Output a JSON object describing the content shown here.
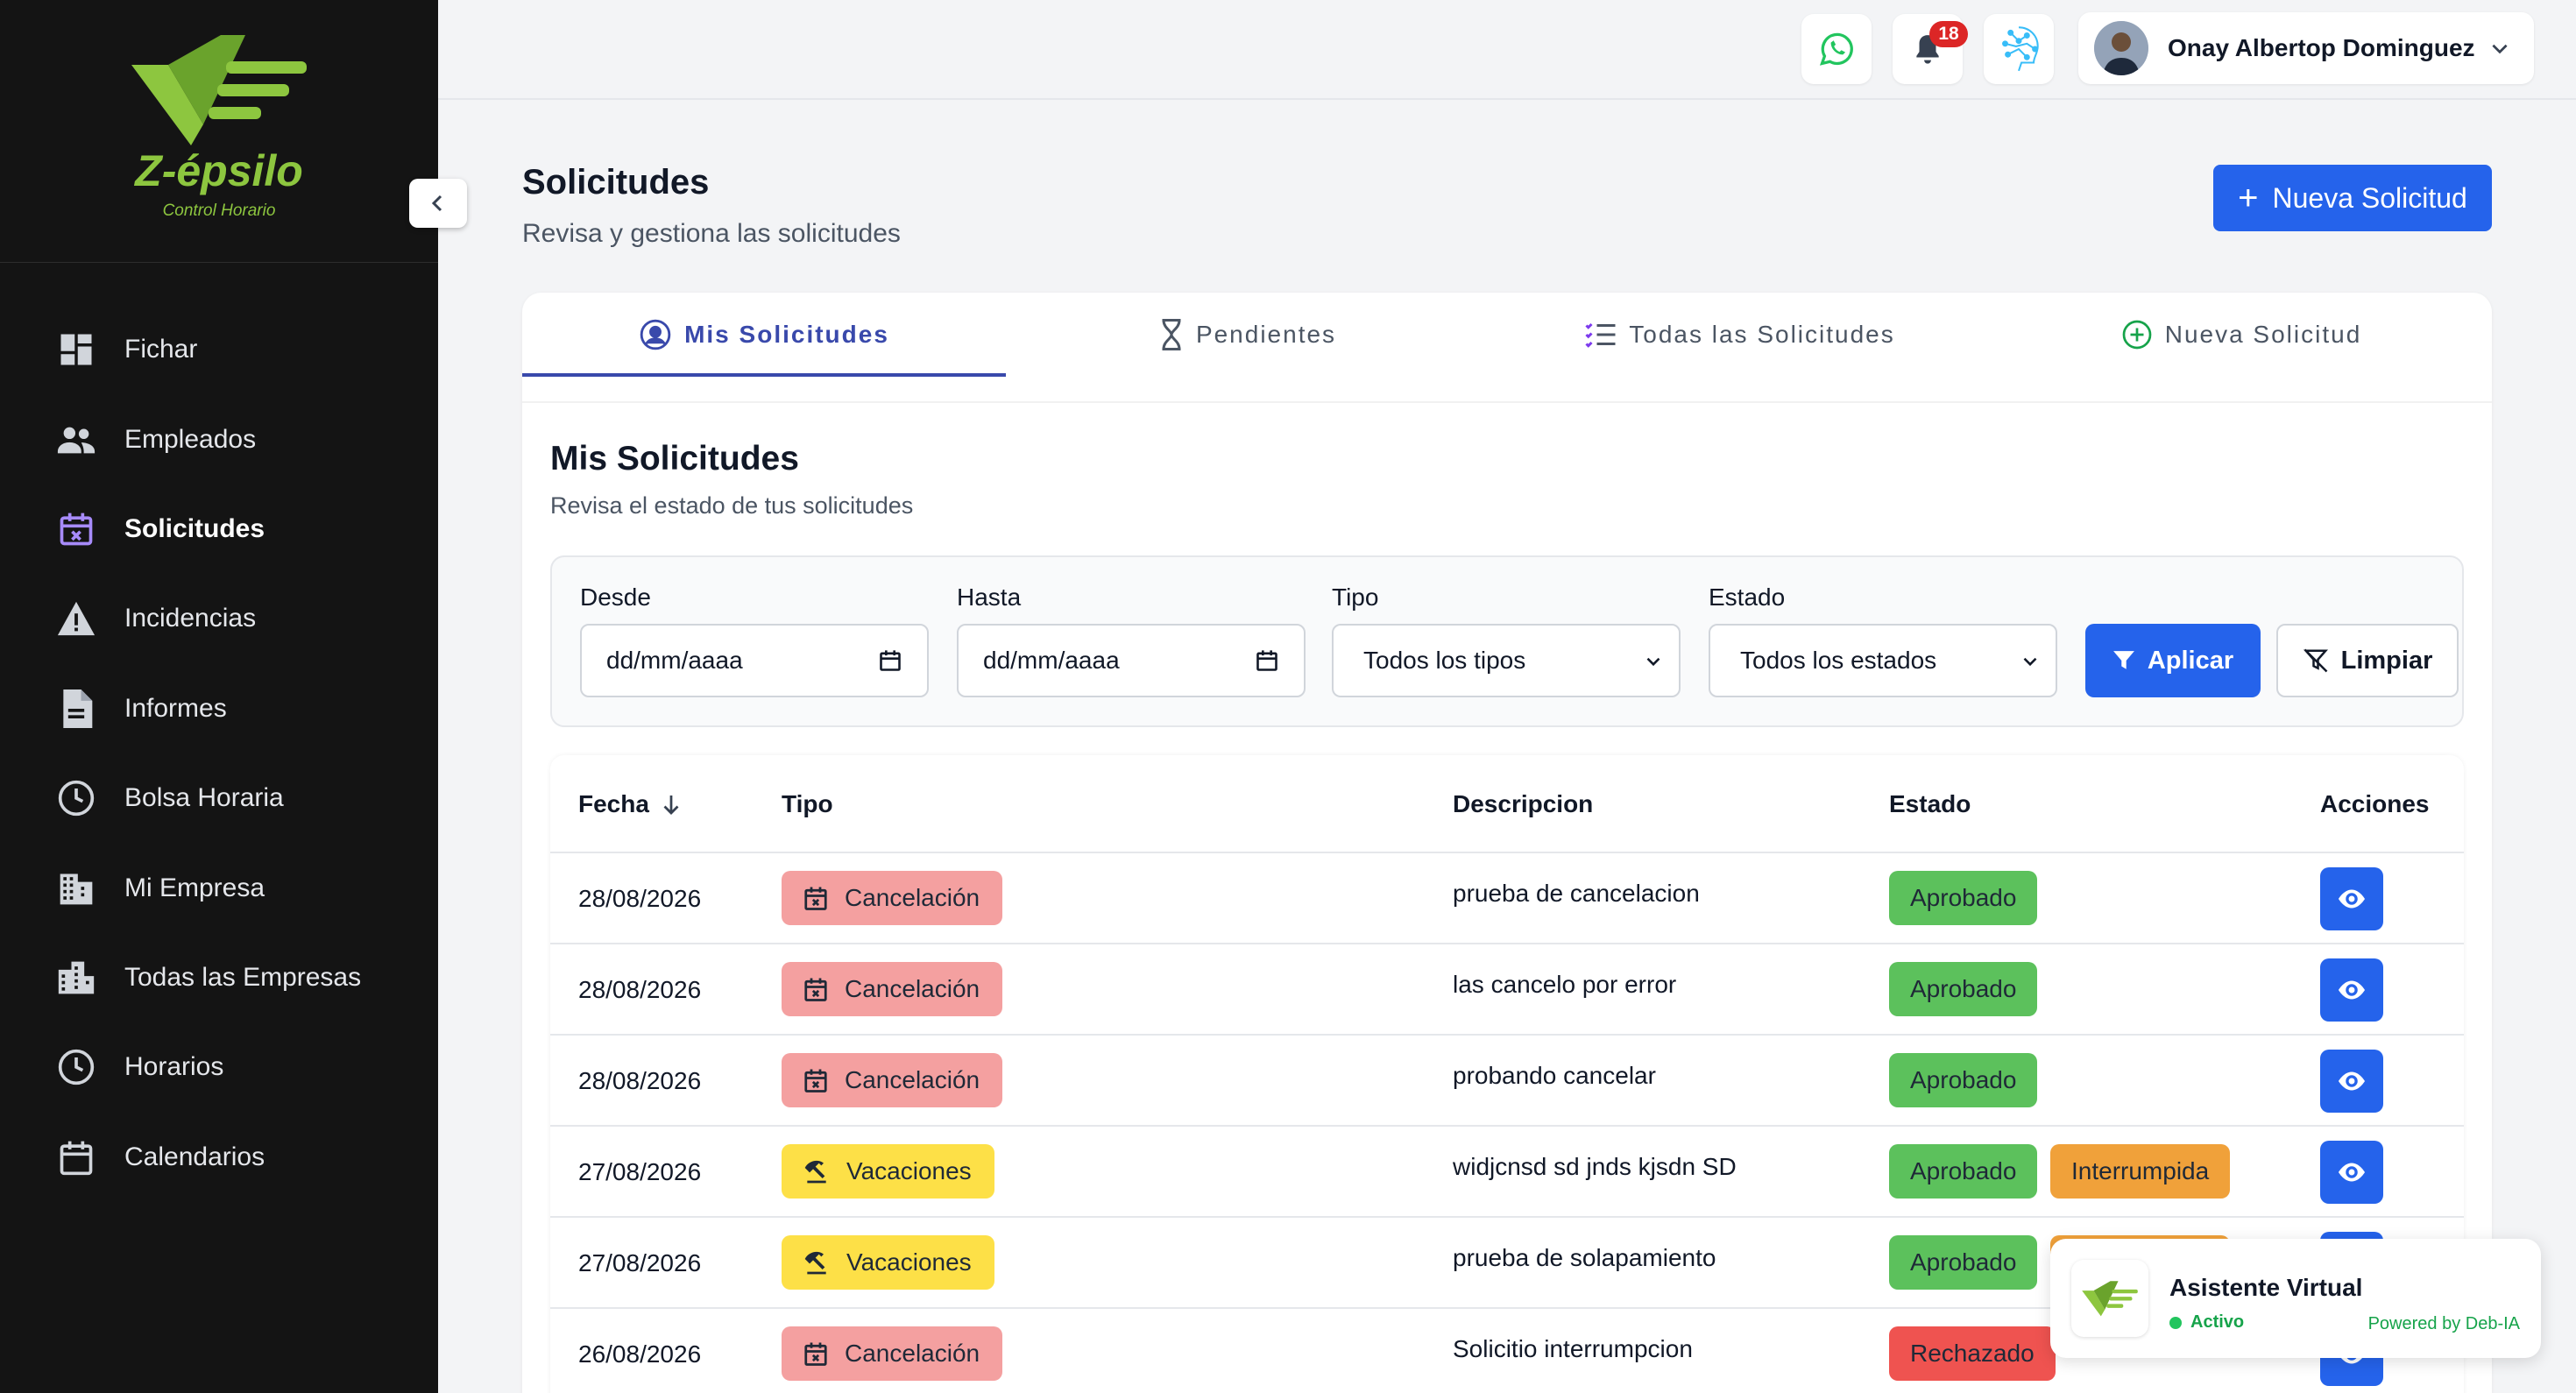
{
  "brand": {
    "name": "Z-épsilo",
    "subtitle": "Control Horario",
    "color": "#8dc63f"
  },
  "sidebar": {
    "items": [
      {
        "label": "Fichar",
        "icon": "dashboard-icon"
      },
      {
        "label": "Empleados",
        "icon": "people-icon"
      },
      {
        "label": "Solicitudes",
        "icon": "calendar-x-icon",
        "active": true
      },
      {
        "label": "Incidencias",
        "icon": "warning-icon"
      },
      {
        "label": "Informes",
        "icon": "document-icon"
      },
      {
        "label": "Bolsa Horaria",
        "icon": "clock-icon"
      },
      {
        "label": "Mi Empresa",
        "icon": "building-icon"
      },
      {
        "label": "Todas las Empresas",
        "icon": "buildings-icon"
      },
      {
        "label": "Horarios",
        "icon": "clock-icon"
      },
      {
        "label": "Calendarios",
        "icon": "calendar-icon"
      }
    ]
  },
  "topbar": {
    "notifications_count": "18",
    "user_name": "Onay Albertop Dominguez"
  },
  "page": {
    "title": "Solicitudes",
    "subtitle": "Revisa y gestiona las solicitudes",
    "new_button": "Nueva Solicitud"
  },
  "tabs": [
    {
      "label": "Mis Solicitudes",
      "icon": "user-circle-icon",
      "active": true
    },
    {
      "label": "Pendientes",
      "icon": "hourglass-icon"
    },
    {
      "label": "Todas las Solicitudes",
      "icon": "list-check-icon"
    },
    {
      "label": "Nueva Solicitud",
      "icon": "plus-circle-icon"
    }
  ],
  "section": {
    "title": "Mis Solicitudes",
    "subtitle": "Revisa el estado de tus solicitudes"
  },
  "filters": {
    "desde_label": "Desde",
    "desde_value": "dd/mm/aaaa",
    "hasta_label": "Hasta",
    "hasta_value": "dd/mm/aaaa",
    "tipo_label": "Tipo",
    "tipo_value": "Todos los tipos",
    "estado_label": "Estado",
    "estado_value": "Todos los estados",
    "apply_label": "Aplicar",
    "clear_label": "Limpiar"
  },
  "table": {
    "headers": {
      "fecha": "Fecha",
      "tipo": "Tipo",
      "descripcion": "Descripcion",
      "estado": "Estado",
      "acciones": "Acciones"
    },
    "rows": [
      {
        "fecha": "28/08/2026",
        "tipo": "Cancelación",
        "kind": "cancel",
        "descripcion": "prueba de cancelacion",
        "estado": "Aprobado",
        "estado_kind": "green",
        "extra": ""
      },
      {
        "fecha": "28/08/2026",
        "tipo": "Cancelación",
        "kind": "cancel",
        "descripcion": "las cancelo por error",
        "estado": "Aprobado",
        "estado_kind": "green",
        "extra": ""
      },
      {
        "fecha": "28/08/2026",
        "tipo": "Cancelación",
        "kind": "cancel",
        "descripcion": "probando cancelar",
        "estado": "Aprobado",
        "estado_kind": "green",
        "extra": ""
      },
      {
        "fecha": "27/08/2026",
        "tipo": "Vacaciones",
        "kind": "vac",
        "descripcion": "widjcnsd sd jnds kjsdn SD",
        "estado": "Aprobado",
        "estado_kind": "green",
        "extra": "Interrumpida"
      },
      {
        "fecha": "27/08/2026",
        "tipo": "Vacaciones",
        "kind": "vac",
        "descripcion": "prueba de solapamiento",
        "estado": "Aprobado",
        "estado_kind": "green",
        "extra": "Interrumpida"
      },
      {
        "fecha": "26/08/2026",
        "tipo": "Cancelación",
        "kind": "cancel",
        "descripcion": "Solicitio interrumpcion",
        "estado": "Rechazado",
        "estado_kind": "red",
        "extra": ""
      }
    ]
  },
  "assistant": {
    "title": "Asistente Virtual",
    "status": "Activo",
    "powered": "Powered by Deb-IA"
  },
  "colors": {
    "primary": "#2563eb",
    "tab_active": "#3949ab",
    "approved": "#5cc15c",
    "rejected": "#ef5350",
    "interrupted": "#f0a13a"
  }
}
